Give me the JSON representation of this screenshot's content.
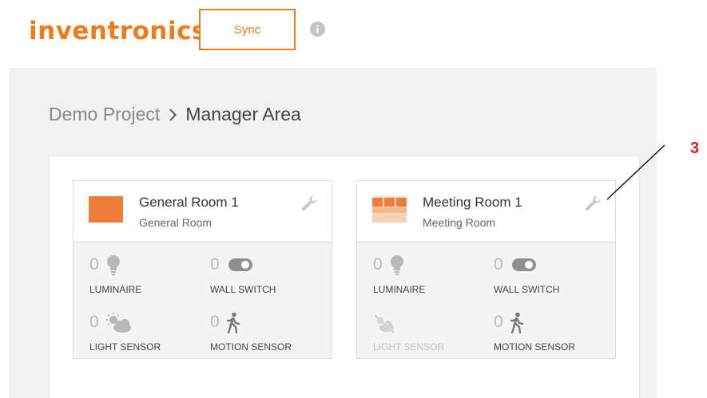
{
  "header": {
    "logo_text": "inventronics",
    "sync_label": "Sync"
  },
  "breadcrumb": {
    "project": "Demo Project",
    "current": "Manager Area"
  },
  "rooms": [
    {
      "name": "General Room 1",
      "type": "General Room",
      "icon": "general-room-icon",
      "devices": [
        {
          "count": "0",
          "label": "LUMINAIRE",
          "icon": "bulb-icon"
        },
        {
          "count": "0",
          "label": "WALL SWITCH",
          "icon": "toggle-switch-icon"
        },
        {
          "count": "0",
          "label": "LIGHT SENSOR",
          "icon": "sun-cloud-icon"
        },
        {
          "count": "0",
          "label": "MOTION SENSOR",
          "icon": "walking-person-icon"
        }
      ]
    },
    {
      "name": "Meeting Room 1",
      "type": "Meeting Room",
      "icon": "meeting-room-icon",
      "devices": [
        {
          "count": "0",
          "label": "LUMINAIRE",
          "icon": "bulb-icon"
        },
        {
          "count": "0",
          "label": "WALL SWITCH",
          "icon": "toggle-switch-icon"
        },
        {
          "count": "",
          "label": "LIGHT SENSOR",
          "icon": "sun-cloud-off-icon",
          "disabled": true
        },
        {
          "count": "0",
          "label": "MOTION SENSOR",
          "icon": "walking-person-icon"
        }
      ]
    }
  ],
  "annotation": {
    "number": "3"
  },
  "colors": {
    "brand": "#ef7c1c",
    "panel": "#f1f1f1",
    "callout": "#e0191c",
    "icon_gray": "#b8b8b8"
  }
}
